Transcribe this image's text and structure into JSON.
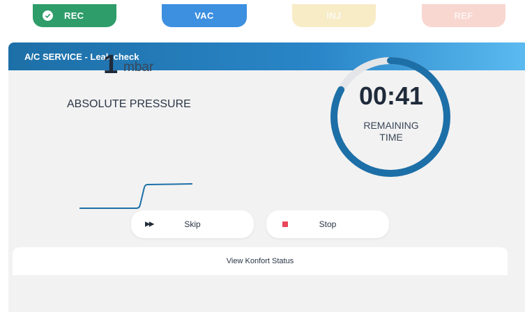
{
  "stages": [
    {
      "label": "REC",
      "state": "done",
      "color": "#2e9d69"
    },
    {
      "label": "VAC",
      "state": "active",
      "color": "#3d8fe0"
    },
    {
      "label": "INJ",
      "state": "pending",
      "color": "#f7ecc6"
    },
    {
      "label": "REF",
      "state": "pending",
      "color": "#f8d7d0"
    }
  ],
  "panel": {
    "title": "A/C SERVICE - Leak check"
  },
  "pressure": {
    "value": "1",
    "unit": "mbar",
    "label": "ABSOLUTE PRESSURE"
  },
  "timer": {
    "value": "00:41",
    "label_line1": "REMAINING",
    "label_line2": "TIME",
    "progress_fraction": 0.83,
    "ring_color": "#1d6fa7"
  },
  "actions": {
    "skip_label": "Skip",
    "skip_icon": "fast-forward-icon",
    "stop_label": "Stop",
    "stop_icon": "stop-square-icon",
    "stop_color": "#e8475a"
  },
  "footer": {
    "konfort_label": "View Konfort Status"
  }
}
